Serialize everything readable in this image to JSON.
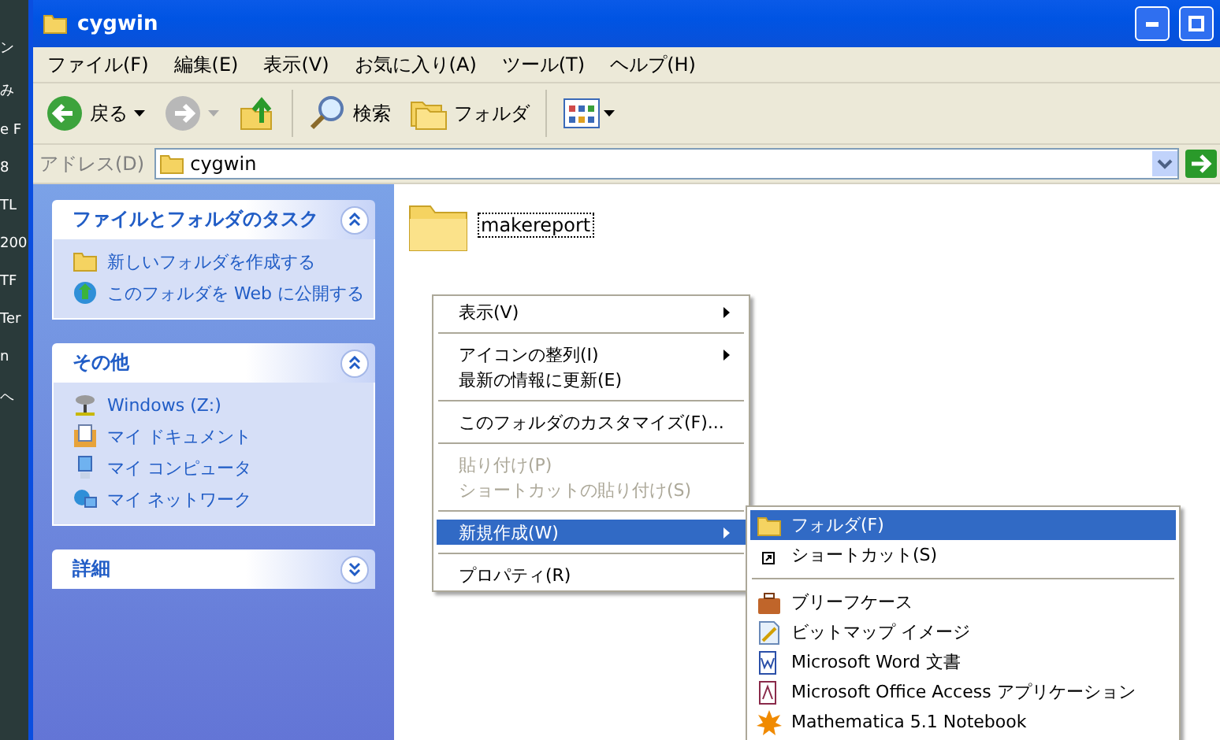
{
  "desktop": {
    "labels": [
      "ン",
      "み",
      "e F",
      "8",
      "TL",
      "200",
      "TF",
      "Ter",
      "n",
      "ヘ"
    ]
  },
  "window": {
    "title": "cygwin"
  },
  "menu_bar": [
    "ファイル(F)",
    "編集(E)",
    "表示(V)",
    "お気に入り(A)",
    "ツール(T)",
    "ヘルプ(H)"
  ],
  "toolbar": {
    "back": "戻る",
    "search": "検索",
    "folders": "フォルダ"
  },
  "address": {
    "label": "アドレス(D)",
    "value": "cygwin"
  },
  "task_panels": [
    {
      "title": "ファイルとフォルダのタスク",
      "expanded": true,
      "items": [
        {
          "kind": "new-folder",
          "label": "新しいフォルダを作成する"
        },
        {
          "kind": "publish",
          "label": "このフォルダを Web に公開する"
        }
      ]
    },
    {
      "title": "その他",
      "expanded": true,
      "items": [
        {
          "kind": "drive",
          "label": "Windows (Z:)"
        },
        {
          "kind": "documents",
          "label": "マイ ドキュメント"
        },
        {
          "kind": "computer",
          "label": "マイ コンピュータ"
        },
        {
          "kind": "network",
          "label": "マイ ネットワーク"
        }
      ]
    },
    {
      "title": "詳細",
      "expanded": false
    }
  ],
  "files": [
    {
      "name": "makereport",
      "focused": true
    }
  ],
  "context_menu": [
    {
      "kind": "item",
      "label": "表示(V)",
      "submenu": true,
      "disabled": false,
      "selected": false
    },
    {
      "kind": "separator"
    },
    {
      "kind": "item",
      "label": "アイコンの整列(I)",
      "submenu": true,
      "disabled": false,
      "selected": false
    },
    {
      "kind": "item",
      "label": "最新の情報に更新(E)",
      "submenu": false,
      "disabled": false,
      "selected": false
    },
    {
      "kind": "separator"
    },
    {
      "kind": "item",
      "label": "このフォルダのカスタマイズ(F)...",
      "submenu": false,
      "disabled": false,
      "selected": false
    },
    {
      "kind": "separator"
    },
    {
      "kind": "item",
      "label": "貼り付け(P)",
      "submenu": false,
      "disabled": true,
      "selected": false
    },
    {
      "kind": "item",
      "label": "ショートカットの貼り付け(S)",
      "submenu": false,
      "disabled": true,
      "selected": false
    },
    {
      "kind": "separator"
    },
    {
      "kind": "item",
      "label": "新規作成(W)",
      "submenu": true,
      "disabled": false,
      "selected": true
    },
    {
      "kind": "separator"
    },
    {
      "kind": "item",
      "label": "プロパティ(R)",
      "submenu": false,
      "disabled": false,
      "selected": false
    }
  ],
  "new_submenu": [
    {
      "kind": "folder",
      "label": "フォルダ(F)",
      "selected": true
    },
    {
      "kind": "shortcut",
      "label": "ショートカット(S)",
      "selected": false
    },
    {
      "kind": "separator"
    },
    {
      "kind": "briefcase",
      "label": "ブリーフケース",
      "selected": false
    },
    {
      "kind": "bitmap",
      "label": "ビットマップ イメージ",
      "selected": false
    },
    {
      "kind": "word",
      "label": "Microsoft Word 文書",
      "selected": false
    },
    {
      "kind": "access",
      "label": "Microsoft Office Access アプリケーション",
      "selected": false
    },
    {
      "kind": "mathematica",
      "label": "Mathematica 5.1 Notebook",
      "selected": false
    }
  ]
}
